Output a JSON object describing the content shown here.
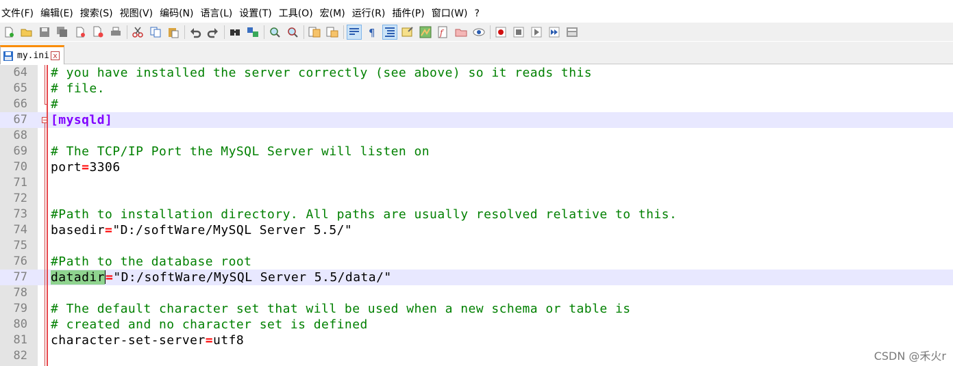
{
  "menu": [
    "文件(F)",
    "编辑(E)",
    "搜索(S)",
    "视图(V)",
    "编码(N)",
    "语言(L)",
    "设置(T)",
    "工具(O)",
    "宏(M)",
    "运行(R)",
    "插件(P)",
    "窗口(W)",
    "?"
  ],
  "toolbar_icons": [
    "new-file-icon",
    "open-file-icon",
    "save-icon",
    "save-all-icon",
    "close-icon",
    "close-all-icon",
    "print-icon",
    "cut-icon",
    "copy-icon",
    "paste-icon",
    "undo-icon",
    "redo-icon",
    "find-icon",
    "replace-icon",
    "zoom-in-icon",
    "zoom-out-icon",
    "sync-vertical-icon",
    "sync-horizontal-icon",
    "word-wrap-icon",
    "show-all-chars-icon",
    "indent-guide-icon",
    "user-language-icon",
    "doc-map-icon",
    "function-list-icon",
    "folder-workspace-icon",
    "monitor-icon",
    "record-macro-icon",
    "stop-record-icon",
    "play-macro-icon",
    "run-macro-multiple-icon",
    "save-macro-icon"
  ],
  "tab": {
    "label": "my.ini",
    "close": "x"
  },
  "lines": [
    {
      "n": "64",
      "text": "# you have installed the server correctly (see above) so it reads this"
    },
    {
      "n": "65",
      "text": "# file."
    },
    {
      "n": "66",
      "text": "#"
    },
    {
      "n": "67",
      "text": "[mysqld]"
    },
    {
      "n": "68",
      "text": ""
    },
    {
      "n": "69",
      "text": "# The TCP/IP Port the MySQL Server will listen on"
    },
    {
      "n": "70",
      "key": "port",
      "op": "=",
      "val": "3306"
    },
    {
      "n": "71",
      "text": ""
    },
    {
      "n": "72",
      "text": ""
    },
    {
      "n": "73",
      "text": "#Path to installation directory. All paths are usually resolved relative to this."
    },
    {
      "n": "74",
      "key": "basedir",
      "op": "=",
      "val": "\"D:/softWare/MySQL Server 5.5/\""
    },
    {
      "n": "75",
      "text": ""
    },
    {
      "n": "76",
      "text": "#Path to the database root"
    },
    {
      "n": "77",
      "key": "datadir",
      "op": "=",
      "val": "\"D:/softWare/MySQL Server 5.5/data/\""
    },
    {
      "n": "78",
      "text": ""
    },
    {
      "n": "79",
      "text": "# The default character set that will be used when a new schema or table is"
    },
    {
      "n": "80",
      "text": "# created and no character set is defined"
    },
    {
      "n": "81",
      "key": "character-set-server",
      "op": "=",
      "val": "utf8"
    },
    {
      "n": "82",
      "text": ""
    }
  ],
  "watermark": "CSDN @禾火r",
  "colors": {
    "comment": "#008000",
    "section": "#8000ff",
    "operator": "#ff0000",
    "gutter": "#e4e4e4",
    "current_line": "#e8e8ff",
    "selection": "#8fd48f",
    "tab_accent": "#fa8c00"
  }
}
